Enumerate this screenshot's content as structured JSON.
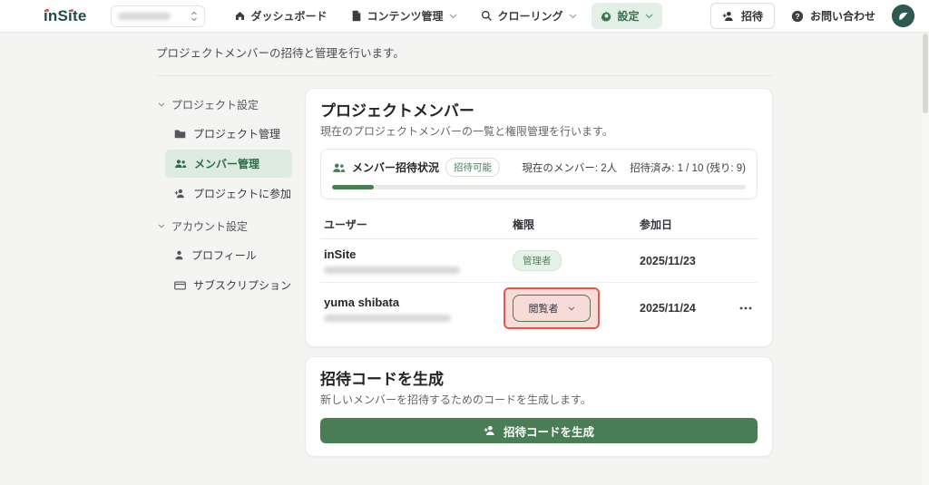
{
  "header": {
    "logo": "inSite",
    "nav": [
      {
        "label": "ダッシュボード"
      },
      {
        "label": "コンテンツ管理"
      },
      {
        "label": "クローリング"
      },
      {
        "label": "設定"
      }
    ],
    "invite_button_label": "招待",
    "contact_label": "お問い合わせ"
  },
  "page": {
    "subtitle": "プロジェクトメンバーの招待と管理を行います。"
  },
  "sidebar": {
    "groups": [
      {
        "label": "プロジェクト設定",
        "items": [
          {
            "label": "プロジェクト管理"
          },
          {
            "label": "メンバー管理",
            "active": true
          },
          {
            "label": "プロジェクトに参加"
          }
        ]
      },
      {
        "label": "アカウント設定",
        "items": [
          {
            "label": "プロフィール"
          },
          {
            "label": "サブスクリプション"
          }
        ]
      }
    ]
  },
  "members_card": {
    "title": "プロジェクトメンバー",
    "subtitle": "現在のプロジェクトメンバーの一覧と権限管理を行います。",
    "status": {
      "label": "メンバー招待状況",
      "badge": "招待可能",
      "members_summary": "現在のメンバー: 2人",
      "invites_summary": "招待済み: 1 / 10 (残り: 9)",
      "progress_percent": 10
    },
    "table": {
      "headers": [
        "ユーザー",
        "権限",
        "参加日"
      ],
      "rows": [
        {
          "name": "inSite",
          "role": "管理者",
          "joined": "2025/11/23"
        },
        {
          "name": "yuma shibata",
          "role": "閲覧者",
          "joined": "2025/11/24"
        }
      ]
    }
  },
  "invite_card": {
    "title": "招待コードを生成",
    "subtitle": "新しいメンバーを招待するためのコードを生成します。",
    "button_label": "招待コードを生成"
  },
  "colors": {
    "primary_green": "#4a7c55",
    "active_light_green": "#e4efe7",
    "logo_teal": "#1f4a48",
    "highlight_red": "#e2574f",
    "badge_green_bg": "#e6f1e8"
  }
}
